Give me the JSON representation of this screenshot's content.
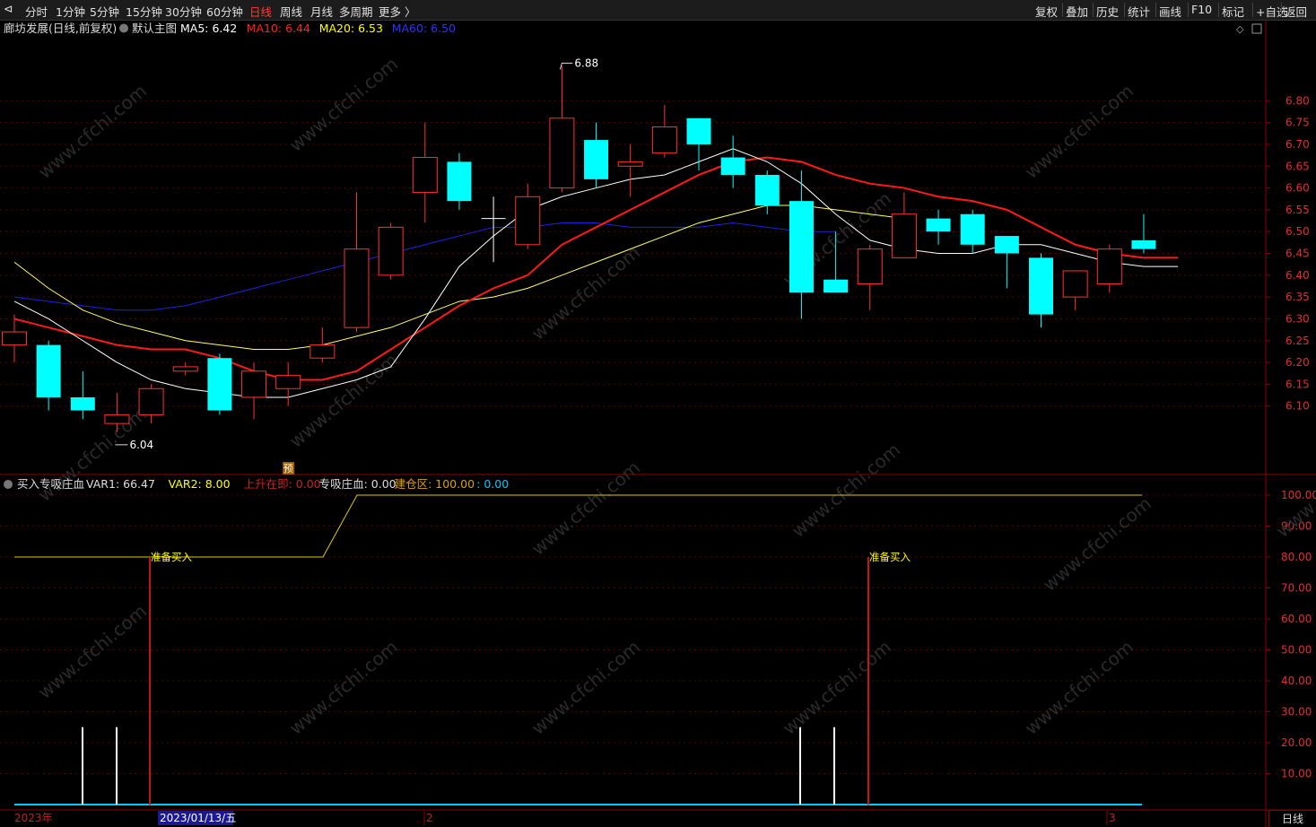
{
  "toolbar": {
    "corner_icon": "chevron-left-icon",
    "periods": [
      "分时",
      "1分钟",
      "5分钟",
      "15分钟",
      "30分钟",
      "60分钟",
      "日线",
      "周线",
      "月线",
      "多周期",
      "更多 〉"
    ],
    "active_period": "日线",
    "right_buttons": [
      "复权",
      "叠加",
      "历史",
      "统计",
      "画线",
      "F10",
      "标记",
      "+自选",
      "返回"
    ]
  },
  "main_pane": {
    "stock_name": "廊坊发展(日线,前复权)",
    "template_name": "默认主图",
    "ma_labels": [
      {
        "text": "MA5: 6.42",
        "color": "#ffffff"
      },
      {
        "text": "MA10: 6.44",
        "color": "#ff2020"
      },
      {
        "text": "MA20: 6.53",
        "color": "#ffff00"
      },
      {
        "text": "MA60: 6.50",
        "color": "#3030ff"
      }
    ],
    "y_ticks": [
      "6.80",
      "6.75",
      "6.70",
      "6.65",
      "6.60",
      "6.55",
      "6.50",
      "6.45",
      "6.40",
      "6.35",
      "6.30",
      "6.25",
      "6.20",
      "6.15",
      "6.10"
    ],
    "high_marker": "6.88",
    "low_marker": "6.04",
    "pre_marker": "预"
  },
  "indicator_pane": {
    "name": "买入专吸庄血",
    "labels": [
      {
        "text": "VAR1: 66.47",
        "color": "#dddddd"
      },
      {
        "text": "VAR2: 8.00",
        "color": "#ffff00"
      },
      {
        "text": "上升在即: 0.00",
        "color": "#d02020"
      },
      {
        "text": "专吸庄血: 0.00",
        "color": "#dddddd"
      },
      {
        "text": "建仓区: 100.00",
        "color": "#e0a000"
      },
      {
        "text": ": 0.00",
        "color": "#00c8ff"
      }
    ],
    "y_ticks": [
      "100.00",
      "90.00",
      "80.00",
      "70.00",
      "60.00",
      "50.00",
      "40.00",
      "30.00",
      "20.00",
      "10.00"
    ],
    "signal_labels": [
      "准备买入",
      "准备买入"
    ]
  },
  "x_axis": {
    "labels": [
      "2023年",
      "2",
      "3"
    ],
    "cursor_date": "2023/01/13/五"
  },
  "period_corner": "日线",
  "watermark": "www.cfchi.com",
  "chart_data": {
    "type": "candlestick",
    "y_range": [
      6.04,
      6.88
    ],
    "candles": [
      {
        "o": 6.24,
        "c": 6.27,
        "h": 6.31,
        "l": 6.2
      },
      {
        "o": 6.24,
        "c": 6.12,
        "h": 6.25,
        "l": 6.09
      },
      {
        "o": 6.12,
        "c": 6.09,
        "h": 6.18,
        "l": 6.07
      },
      {
        "o": 6.06,
        "c": 6.08,
        "h": 6.13,
        "l": 6.04
      },
      {
        "o": 6.08,
        "c": 6.14,
        "h": 6.15,
        "l": 6.06
      },
      {
        "o": 6.18,
        "c": 6.19,
        "h": 6.2,
        "l": 6.17
      },
      {
        "o": 6.21,
        "c": 6.09,
        "h": 6.22,
        "l": 6.08
      },
      {
        "o": 6.12,
        "c": 6.18,
        "h": 6.2,
        "l": 6.07
      },
      {
        "o": 6.14,
        "c": 6.17,
        "h": 6.2,
        "l": 6.1
      },
      {
        "o": 6.21,
        "c": 6.24,
        "h": 6.28,
        "l": 6.2
      },
      {
        "o": 6.28,
        "c": 6.46,
        "h": 6.59,
        "l": 6.27
      },
      {
        "o": 6.4,
        "c": 6.51,
        "h": 6.52,
        "l": 6.39
      },
      {
        "o": 6.59,
        "c": 6.67,
        "h": 6.75,
        "l": 6.52
      },
      {
        "o": 6.66,
        "c": 6.57,
        "h": 6.68,
        "l": 6.55
      },
      {
        "o": 6.53,
        "c": 6.53,
        "h": 6.58,
        "l": 6.43
      },
      {
        "o": 6.47,
        "c": 6.58,
        "h": 6.61,
        "l": 6.46
      },
      {
        "o": 6.6,
        "c": 6.76,
        "h": 6.88,
        "l": 6.59
      },
      {
        "o": 6.71,
        "c": 6.62,
        "h": 6.75,
        "l": 6.6
      },
      {
        "o": 6.65,
        "c": 6.66,
        "h": 6.7,
        "l": 6.58
      },
      {
        "o": 6.68,
        "c": 6.74,
        "h": 6.79,
        "l": 6.67
      },
      {
        "o": 6.76,
        "c": 6.7,
        "h": 6.76,
        "l": 6.64
      },
      {
        "o": 6.67,
        "c": 6.63,
        "h": 6.72,
        "l": 6.6
      },
      {
        "o": 6.63,
        "c": 6.56,
        "h": 6.64,
        "l": 6.54
      },
      {
        "o": 6.57,
        "c": 6.36,
        "h": 6.64,
        "l": 6.3
      },
      {
        "o": 6.39,
        "c": 6.36,
        "h": 6.5,
        "l": 6.36
      },
      {
        "o": 6.38,
        "c": 6.46,
        "h": 6.47,
        "l": 6.32
      },
      {
        "o": 6.44,
        "c": 6.54,
        "h": 6.59,
        "l": 6.44
      },
      {
        "o": 6.53,
        "c": 6.5,
        "h": 6.55,
        "l": 6.47
      },
      {
        "o": 6.54,
        "c": 6.47,
        "h": 6.55,
        "l": 6.45
      },
      {
        "o": 6.49,
        "c": 6.45,
        "h": 6.49,
        "l": 6.37
      },
      {
        "o": 6.44,
        "c": 6.31,
        "h": 6.45,
        "l": 6.28
      },
      {
        "o": 6.35,
        "c": 6.41,
        "h": 6.41,
        "l": 6.32
      },
      {
        "o": 6.38,
        "c": 6.46,
        "h": 6.47,
        "l": 6.36
      },
      {
        "o": 6.48,
        "c": 6.46,
        "h": 6.54,
        "l": 6.45
      }
    ],
    "ma5": [
      6.34,
      6.3,
      6.25,
      6.2,
      6.16,
      6.14,
      6.13,
      6.12,
      6.12,
      6.14,
      6.16,
      6.19,
      6.3,
      6.42,
      6.49,
      6.55,
      6.58,
      6.6,
      6.62,
      6.63,
      6.66,
      6.69,
      6.66,
      6.61,
      6.54,
      6.48,
      6.46,
      6.45,
      6.45,
      6.47,
      6.47,
      6.45,
      6.43,
      6.42,
      6.42
    ],
    "ma10": [
      6.3,
      6.28,
      6.26,
      6.24,
      6.23,
      6.23,
      6.21,
      6.18,
      6.16,
      6.16,
      6.18,
      6.23,
      6.28,
      6.33,
      6.37,
      6.4,
      6.47,
      6.51,
      6.55,
      6.59,
      6.63,
      6.66,
      6.67,
      6.66,
      6.63,
      6.61,
      6.6,
      6.58,
      6.57,
      6.55,
      6.51,
      6.47,
      6.45,
      6.44,
      6.44
    ],
    "ma20": [
      6.43,
      6.37,
      6.32,
      6.29,
      6.27,
      6.25,
      6.24,
      6.23,
      6.23,
      6.24,
      6.26,
      6.28,
      6.31,
      6.34,
      6.35,
      6.37,
      6.4,
      6.43,
      6.46,
      6.49,
      6.52,
      6.54,
      6.56,
      6.56,
      6.55,
      6.54,
      6.53
    ],
    "ma60": [
      6.35,
      6.34,
      6.33,
      6.32,
      6.32,
      6.33,
      6.35,
      6.37,
      6.39,
      6.41,
      6.43,
      6.45,
      6.47,
      6.49,
      6.51,
      6.51,
      6.52,
      6.52,
      6.51,
      6.51,
      6.51,
      6.52,
      6.51,
      6.5,
      6.5
    ],
    "indicator": {
      "var_line": [
        80,
        80,
        80,
        80,
        80,
        80,
        80,
        80,
        80,
        80,
        100,
        100,
        100,
        100,
        100,
        100,
        100,
        100,
        100,
        100,
        100,
        100,
        100,
        100,
        100,
        100,
        100,
        100,
        100,
        100,
        100,
        100,
        100,
        100,
        100
      ],
      "white_bars_at": [
        2,
        3,
        23,
        24
      ],
      "white_bar_value": 25,
      "red_signal_at": [
        4,
        25
      ],
      "red_signal_value": 80,
      "baseline_value": 0
    }
  }
}
